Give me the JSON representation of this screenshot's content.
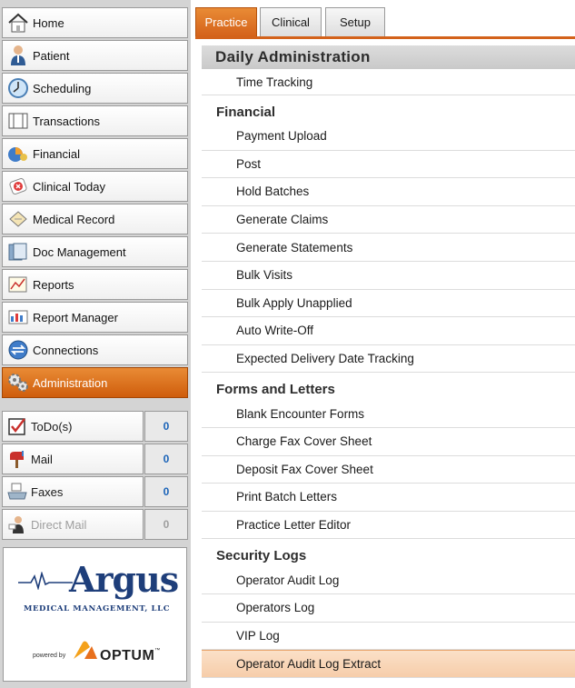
{
  "sidebar": {
    "nav": [
      {
        "label": "Home",
        "icon": "home-icon"
      },
      {
        "label": "Patient",
        "icon": "patient-icon"
      },
      {
        "label": "Scheduling",
        "icon": "clock-icon"
      },
      {
        "label": "Transactions",
        "icon": "transactions-icon"
      },
      {
        "label": "Financial",
        "icon": "financial-icon"
      },
      {
        "label": "Clinical Today",
        "icon": "clinical-icon"
      },
      {
        "label": "Medical Record",
        "icon": "medical-record-icon"
      },
      {
        "label": "Doc Management",
        "icon": "document-icon"
      },
      {
        "label": "Reports",
        "icon": "reports-icon"
      },
      {
        "label": "Report Manager",
        "icon": "report-manager-icon"
      },
      {
        "label": "Connections",
        "icon": "connections-icon"
      },
      {
        "label": "Administration",
        "icon": "gears-icon",
        "active": true
      }
    ],
    "counters": [
      {
        "label": "ToDo(s)",
        "count": "0",
        "icon": "todo-check-icon"
      },
      {
        "label": "Mail",
        "count": "0",
        "icon": "mailbox-icon"
      },
      {
        "label": "Faxes",
        "count": "0",
        "icon": "fax-icon"
      },
      {
        "label": "Direct Mail",
        "count": "0",
        "icon": "direct-mail-icon",
        "disabled": true
      }
    ],
    "logo": {
      "brand": "Argus",
      "tagline": "Medical Management, LLC",
      "powered_by": "powered by",
      "optum": "OPTUM",
      "tm": "™"
    }
  },
  "tabs": [
    {
      "label": "Practice",
      "active": true
    },
    {
      "label": "Clinical"
    },
    {
      "label": "Setup"
    }
  ],
  "main": {
    "header": "Daily Administration",
    "top_items": [
      "Time Tracking"
    ],
    "groups": [
      {
        "title": "Financial",
        "items": [
          "Payment Upload",
          "Post",
          "Hold Batches",
          "Generate Claims",
          "Generate Statements",
          "Bulk Visits",
          "Bulk Apply Unapplied",
          "Auto Write-Off",
          "Expected Delivery Date Tracking"
        ]
      },
      {
        "title": "Forms and Letters",
        "items": [
          "Blank Encounter Forms",
          "Charge Fax Cover Sheet",
          "Deposit Fax Cover Sheet",
          "Print Batch Letters",
          "Practice Letter Editor"
        ]
      },
      {
        "title": "Security Logs",
        "items": [
          "Operator Audit Log",
          "Operators Log",
          "VIP Log",
          "Operator Audit Log Extract"
        ]
      }
    ],
    "highlighted": "Operator Audit Log Extract"
  },
  "colors": {
    "accent": "#d3621a",
    "argus_blue": "#1e3e7a",
    "count_blue": "#1a63b8"
  }
}
